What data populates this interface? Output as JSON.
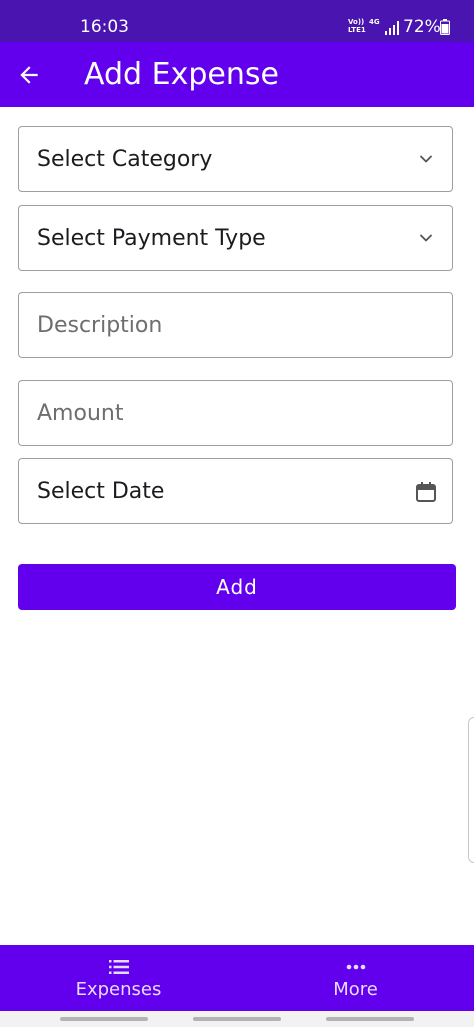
{
  "status_bar": {
    "time": "16:03",
    "network_label": "Vo))\nLTE1",
    "network_type": "4G",
    "battery": "72%"
  },
  "app_bar": {
    "title": "Add Expense",
    "icon": "arrow-left-icon"
  },
  "form": {
    "category": {
      "label": "Select Category",
      "icon": "chevron-down-icon"
    },
    "payment_type": {
      "label": "Select Payment Type",
      "icon": "chevron-down-icon"
    },
    "description": {
      "value": "",
      "placeholder": "Description"
    },
    "amount": {
      "value": "",
      "placeholder": "Amount"
    },
    "date": {
      "label": "Select Date",
      "icon": "calendar-icon"
    },
    "submit_label": "Add"
  },
  "bottom_nav": {
    "items": [
      {
        "label": "Expenses",
        "icon": "list-icon"
      },
      {
        "label": "More",
        "icon": "more-horizontal-icon"
      }
    ]
  },
  "colors": {
    "primary": "#6200ee",
    "status_bar": "#4a14b0",
    "on_primary": "#ffffff",
    "outline": "#9e9e9e"
  }
}
